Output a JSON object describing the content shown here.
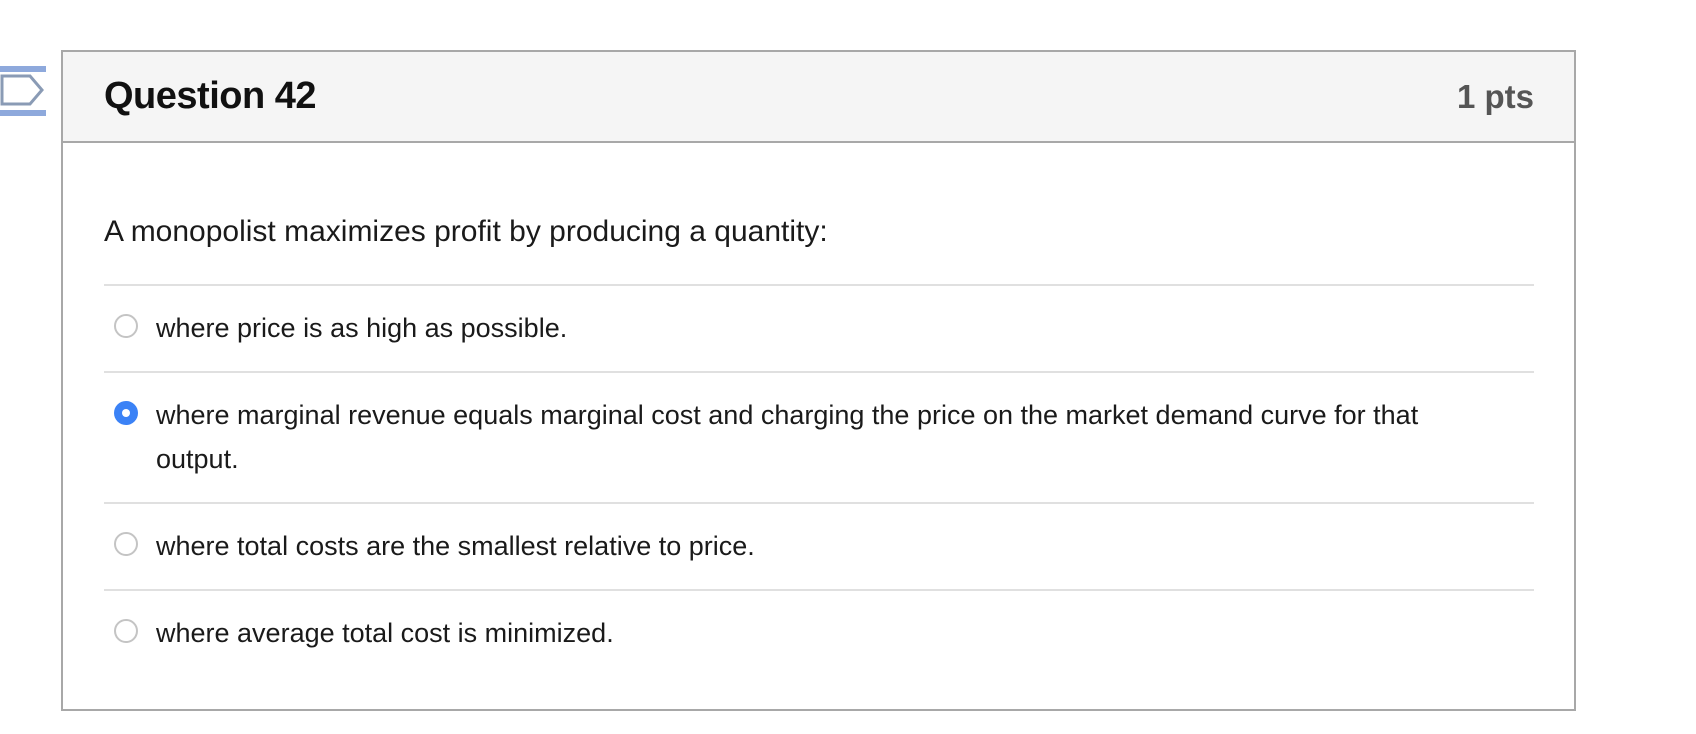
{
  "question": {
    "title": "Question 42",
    "points": "1 pts",
    "text": "A monopolist maximizes profit by producing a quantity:",
    "selected_index": 1,
    "answers": [
      {
        "label": "where price is as high as possible.",
        "selected": false
      },
      {
        "label": "where marginal revenue equals marginal cost and charging the price on the market demand curve for that output.",
        "selected": true
      },
      {
        "label": "where total costs are the smallest relative to price.",
        "selected": false
      },
      {
        "label": "where average total cost is minimized.",
        "selected": false
      }
    ]
  },
  "colors": {
    "accent": "#3b82f6",
    "flag": "#8ea9dc",
    "header_bg": "#f5f5f5",
    "border": "#a8a8a8"
  },
  "icons": {
    "flag": "flag-question-icon"
  }
}
